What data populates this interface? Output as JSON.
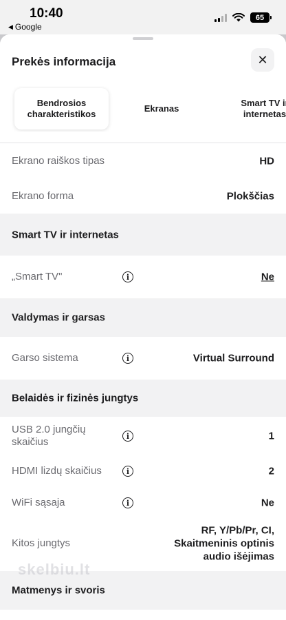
{
  "status_bar": {
    "time": "10:40",
    "back_app": "Google",
    "battery": "65"
  },
  "sheet": {
    "title": "Prekės informacija",
    "close_symbol": "✕",
    "tabs": [
      {
        "label": "Bendrosios\ncharakteristikos",
        "active": true
      },
      {
        "label": "Ekranas",
        "active": false
      },
      {
        "label": "Smart TV ir\ninternetas",
        "active": false
      }
    ]
  },
  "rows_top": [
    {
      "label": "Ekrano raiškos tipas",
      "value": "HD"
    },
    {
      "label": "Ekrano forma",
      "value": "Plokščias"
    }
  ],
  "section_smart": {
    "title": "Smart TV ir internetas",
    "rows": [
      {
        "label": "„Smart TV\"",
        "value": "Ne"
      }
    ]
  },
  "section_control": {
    "title": "Valdymas ir garsas",
    "rows": [
      {
        "label": "Garso sistema",
        "value": "Virtual Surround"
      }
    ]
  },
  "section_ports": {
    "title": "Belaidės ir fizinės jungtys",
    "rows": [
      {
        "label": "USB 2.0 jungčių skaičius",
        "value": "1"
      },
      {
        "label": "HDMI lizdų skaičius",
        "value": "2"
      },
      {
        "label": "WiFi sąsaja",
        "value": "Ne"
      },
      {
        "label": "Kitos jungtys",
        "value": "RF, Y/Pb/Pr, CI,\nSkaitmeninis optinis\naudio išėjimas"
      }
    ]
  },
  "section_dims": {
    "title": "Matmenys ir svoris"
  },
  "watermark": "skelbiu.lt",
  "colors": {
    "background": "#f2f2f3",
    "card": "#ffffff",
    "text": "#1c1c1e",
    "muted": "#6b6b70"
  },
  "icons": {
    "close": "close-icon",
    "info": "info-icon",
    "wifi": "wifi-icon",
    "signal": "signal-icon",
    "battery": "battery-icon"
  }
}
